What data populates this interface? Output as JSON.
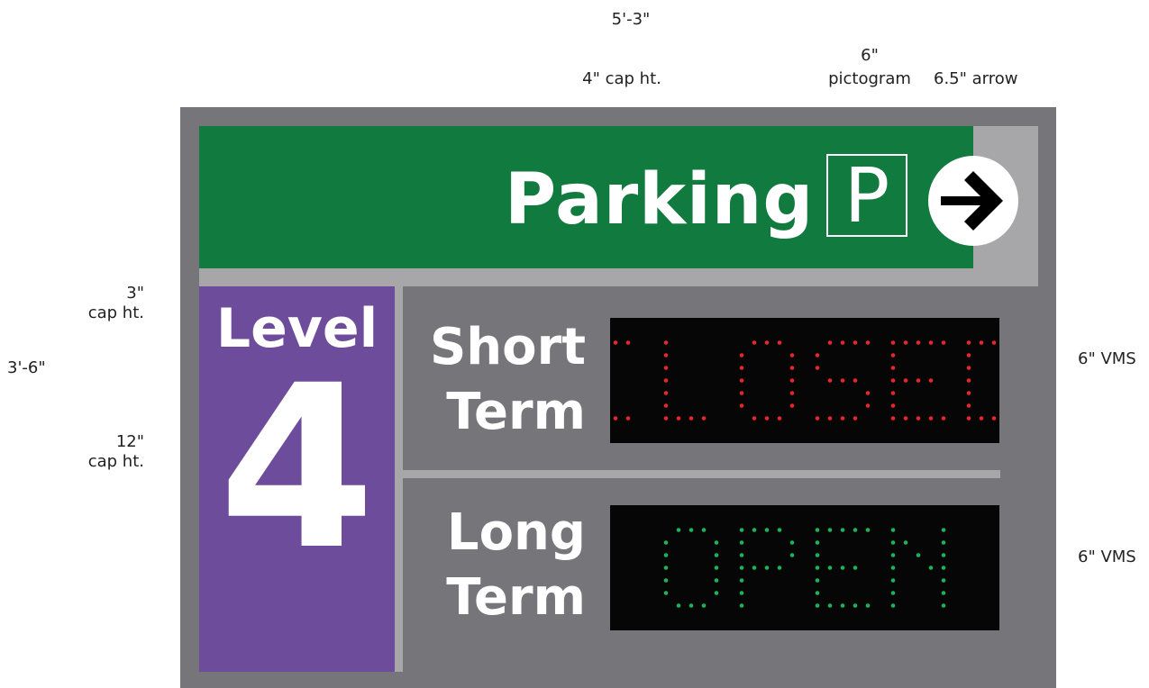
{
  "dimensions": {
    "overall_width": "5'-3\"",
    "header_cap_height": "4\" cap ht.",
    "pictogram_size_value": "6\"",
    "pictogram_label": "pictogram",
    "arrow_size": "6.5\" arrow",
    "level_cap_height_value": "3\"",
    "level_cap_height_label": "cap ht.",
    "overall_height": "3'-6\"",
    "number_cap_height_value": "12\"",
    "number_cap_height_label": "cap ht.",
    "vms_top_label": "6\" VMS",
    "vms_bottom_label": "6\" VMS"
  },
  "header": {
    "title": "Parking",
    "pictogram_letter": "P",
    "arrow_icon": "right-arrow-in-circle-icon"
  },
  "level": {
    "label": "Level",
    "number": "4"
  },
  "rows": [
    {
      "label_line1": "Short",
      "label_line2": "Term",
      "status": "CLOSED",
      "led_color": "#e8262d"
    },
    {
      "label_line1": "Long",
      "label_line2": "Term",
      "status": "OPEN",
      "led_color": "#1bb45b"
    }
  ],
  "colors": {
    "sign_background": "#76767a",
    "header_green": "#117a3e",
    "level_purple": "#6e4c9c",
    "trim_gray": "#a7a7a9",
    "vms_background": "#060606"
  }
}
